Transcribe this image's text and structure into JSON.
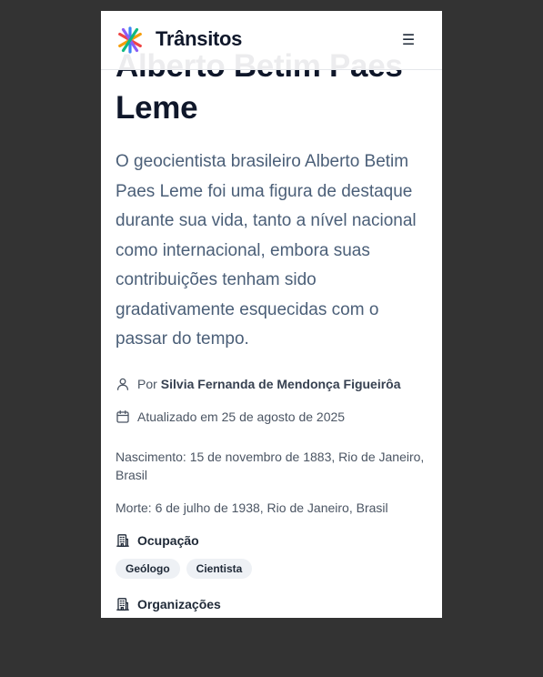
{
  "header": {
    "brand": "Trânsitos",
    "menu_icon": "hamburger-icon"
  },
  "article": {
    "title": "Alberto Betim Paes Leme",
    "lede": "O geocientista brasileiro Alberto Betim Paes Leme foi uma figura de destaque durante sua vida, tanto a nível nacional como internacional, embora suas contribuições tenham sido gradativamente esquecidas com o passar do tempo.",
    "author_prefix": "Por",
    "author": "Silvia Fernanda de Mendonça Figueirôa",
    "updated": "Atualizado em 25 de agosto de 2025",
    "birth": "Nascimento: 15 de novembro de 1883, Rio de Janeiro, Brasil",
    "death": "Morte: 6 de julho de 1938, Rio de Janeiro, Brasil",
    "occupation_label": "Ocupação",
    "occupations": [
      "Geólogo",
      "Cientista"
    ],
    "organizations_label": "Organizações"
  },
  "colors": {
    "background": "#333333",
    "title": "#0f172a",
    "lede": "#4b5f78",
    "chip_bg": "#eef1f5"
  }
}
